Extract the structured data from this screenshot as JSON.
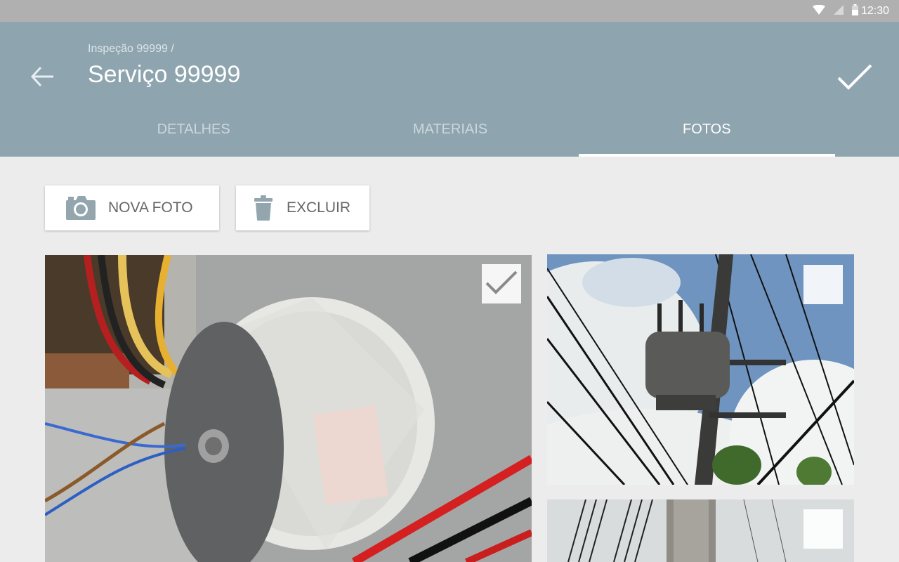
{
  "status_bar": {
    "time": "12:30",
    "icons": [
      "wifi-icon",
      "signal-icon",
      "battery-icon"
    ]
  },
  "header": {
    "breadcrumb": "Inspeção 99999 /",
    "title": "Serviço 99999",
    "back_icon": "arrow-left-icon",
    "confirm_icon": "check-icon"
  },
  "tabs": [
    {
      "label": "DETALHES",
      "active": false
    },
    {
      "label": "MATERIAIS",
      "active": false
    },
    {
      "label": "FOTOS",
      "active": true
    }
  ],
  "actions": {
    "new_photo": {
      "label": "NOVA FOTO",
      "icon": "camera-icon"
    },
    "delete": {
      "label": "EXCLUIR",
      "icon": "trash-icon"
    }
  },
  "photos": [
    {
      "subject": "toroidal-transformer",
      "selected": true
    },
    {
      "subject": "pole-transformer-sky",
      "selected": false
    },
    {
      "subject": "concrete-pole-wires",
      "selected": false
    }
  ],
  "colors": {
    "app_bar": "#8ea4ae",
    "status_bar": "#b0b0b0",
    "background": "#ececec",
    "tab_indicator": "#ffffff",
    "icon_gray": "#93a6ae"
  }
}
